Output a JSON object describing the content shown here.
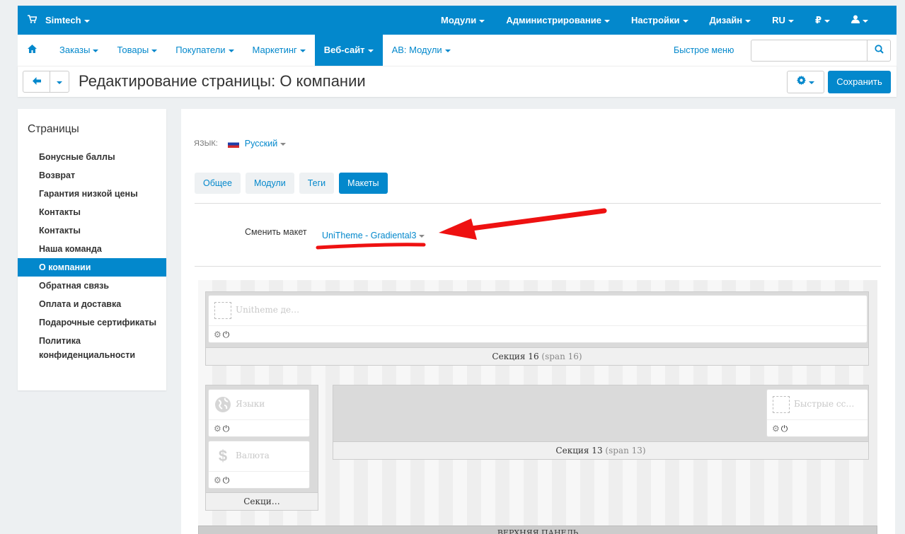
{
  "topbar": {
    "brand": "Simtech",
    "items": [
      "Модули",
      "Администрирование",
      "Настройки",
      "Дизайн",
      "RU",
      "₽"
    ]
  },
  "navbar": {
    "items": [
      "Заказы",
      "Товары",
      "Покупатели",
      "Маркетинг",
      "Веб-сайт",
      "AB: Модули"
    ],
    "quick_menu": "Быстрое меню",
    "search_placeholder": ""
  },
  "titlebar": {
    "title": "Редактирование страницы: О компании",
    "save": "Сохранить"
  },
  "sidebar": {
    "heading": "Страницы",
    "items": [
      "Бонусные баллы",
      "Возврат",
      "Гарантия низкой цены",
      "Контакты",
      "Контакты",
      "Наша команда",
      "О компании",
      "Обратная связь",
      "Оплата и доставка",
      "Подарочные сертификаты",
      "Политика конфиденциальности"
    ]
  },
  "main": {
    "lang_label": "ЯЗЫК:",
    "lang_value": "Русский",
    "tabs": [
      "Общее",
      "Модули",
      "Теги",
      "Макеты"
    ],
    "change_layout_label": "Сменить макет",
    "layout_value": "UniTheme - Gradiental3",
    "blocks": {
      "unitheme": "Unitheme де…",
      "languages": "Языки",
      "currency": "Валюта",
      "quick_links": "Быстрые сс…"
    },
    "sections": {
      "s16": "Секция 16",
      "s16_span": "(span 16)",
      "s13": "Секция 13",
      "s13_span": "(span 13)",
      "s_left": "Секци…",
      "top_panel": "ВЕРХНЯЯ ПАНЕЛЬ"
    }
  },
  "colors": {
    "accent": "#0388cc",
    "annotation": "#ee1111"
  }
}
